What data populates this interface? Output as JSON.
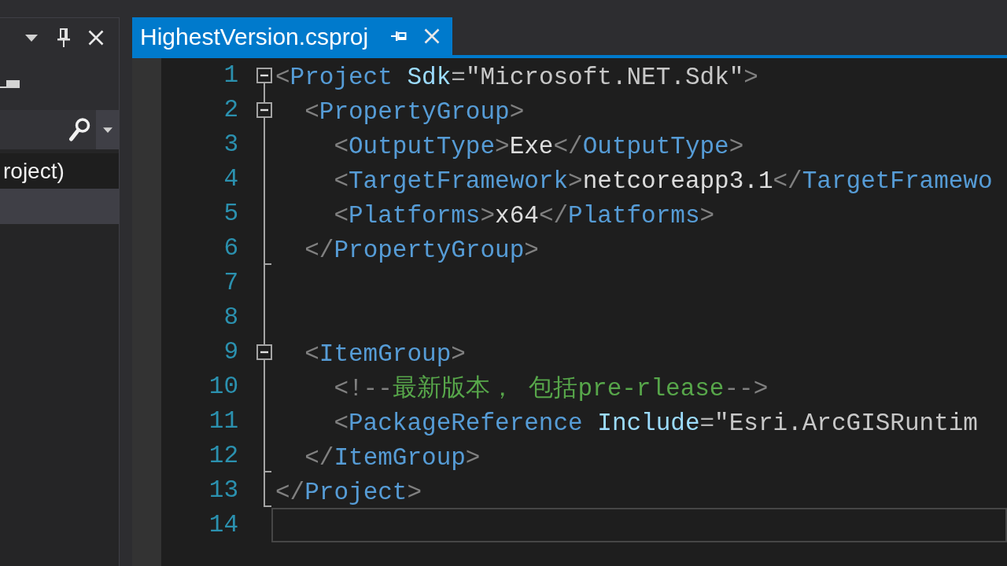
{
  "tool_window": {
    "tree_items": [
      {
        "label": "roject)",
        "selected": false
      },
      {
        "selected": true
      }
    ]
  },
  "tabs": [
    {
      "title": "HighestVersion.csproj",
      "selected": true
    }
  ],
  "editor": {
    "lines": [
      {
        "number": "1",
        "kind": "fold_start",
        "expanded": true,
        "current": false,
        "tokens": [
          {
            "kind": "delimiter",
            "text": "<"
          },
          {
            "kind": "element",
            "text": "Project"
          },
          {
            "kind": "attribute",
            "text": " Sdk"
          },
          {
            "kind": "operator",
            "text": "="
          },
          {
            "kind": "value",
            "text": "\"Microsoft.NET.Sdk\""
          },
          {
            "kind": "delimiter",
            "text": ">"
          }
        ],
        "children": [
          {
            "number": "2",
            "kind": "fold_start",
            "expanded": true,
            "current": false,
            "tokens": [
              {
                "kind": "delimiter",
                "text": "<"
              },
              {
                "kind": "element",
                "text": "PropertyGroup"
              },
              {
                "kind": "delimiter",
                "text": ">"
              }
            ],
            "children": [
              {
                "number": "3",
                "kind": "fold_inner",
                "current": false,
                "tokens": [
                  {
                    "kind": "delimiter",
                    "text": "<"
                  },
                  {
                    "kind": "element",
                    "text": "OutputType"
                  },
                  {
                    "kind": "delimiter",
                    "text": ">"
                  },
                  {
                    "kind": "text",
                    "text": "Exe"
                  },
                  {
                    "kind": "delimiter",
                    "text": "</"
                  },
                  {
                    "kind": "element",
                    "text": "OutputType"
                  },
                  {
                    "kind": "delimiter",
                    "text": ">"
                  }
                ]
              },
              {
                "number": "4",
                "kind": "fold_inner",
                "current": false,
                "tokens": [
                  {
                    "kind": "delimiter",
                    "text": "<"
                  },
                  {
                    "kind": "element",
                    "text": "TargetFramework"
                  },
                  {
                    "kind": "delimiter",
                    "text": ">"
                  },
                  {
                    "kind": "text",
                    "text": "netcoreapp3.1"
                  },
                  {
                    "kind": "delimiter",
                    "text": "</"
                  },
                  {
                    "kind": "element",
                    "text": "TargetFramewo"
                  }
                ]
              },
              {
                "number": "5",
                "kind": "fold_inner",
                "current": false,
                "tokens": [
                  {
                    "kind": "delimiter",
                    "text": "<"
                  },
                  {
                    "kind": "element",
                    "text": "Platforms"
                  },
                  {
                    "kind": "delimiter",
                    "text": ">"
                  },
                  {
                    "kind": "text",
                    "text": "x64"
                  },
                  {
                    "kind": "delimiter",
                    "text": "</"
                  },
                  {
                    "kind": "element",
                    "text": "Platforms"
                  },
                  {
                    "kind": "delimiter",
                    "text": ">"
                  }
                ]
              }
            ]
          },
          {
            "number": "6",
            "kind": "fold_end",
            "current": false,
            "tokens": [
              {
                "kind": "delimiter",
                "text": "</"
              },
              {
                "kind": "element",
                "text": "PropertyGroup"
              },
              {
                "kind": "delimiter",
                "text": ">"
              }
            ]
          },
          {
            "number": "7",
            "kind": "fold_inner",
            "current": false
          },
          {
            "number": "8",
            "kind": "fold_inner",
            "current": false
          },
          {
            "number": "9",
            "kind": "fold_start",
            "expanded": true,
            "current": false,
            "tokens": [
              {
                "kind": "delimiter",
                "text": "<"
              },
              {
                "kind": "element",
                "text": "ItemGroup"
              },
              {
                "kind": "delimiter",
                "text": ">"
              }
            ],
            "children": [
              {
                "number": "10",
                "kind": "fold_inner",
                "current": false,
                "tokens": [
                  {
                    "kind": "delimiter",
                    "text": "<!--"
                  },
                  {
                    "kind": "comment",
                    "text": "最新版本， 包括pre-rlease"
                  },
                  {
                    "kind": "delimiter",
                    "text": "-->"
                  }
                ]
              },
              {
                "number": "11",
                "kind": "fold_inner",
                "current": false,
                "tokens": [
                  {
                    "kind": "delimiter",
                    "text": "<"
                  },
                  {
                    "kind": "element",
                    "text": "PackageReference"
                  },
                  {
                    "kind": "attribute",
                    "text": " Include"
                  },
                  {
                    "kind": "operator",
                    "text": "="
                  },
                  {
                    "kind": "value",
                    "text": "\"Esri.ArcGISRuntim"
                  }
                ]
              }
            ]
          },
          {
            "number": "12",
            "kind": "fold_end",
            "current": false,
            "tokens": [
              {
                "kind": "delimiter",
                "text": "</"
              },
              {
                "kind": "element",
                "text": "ItemGroup"
              },
              {
                "kind": "delimiter",
                "text": ">"
              }
            ]
          }
        ]
      },
      {
        "number": "13",
        "kind": "fold_end",
        "current": false,
        "tokens": [
          {
            "kind": "delimiter",
            "text": "</"
          },
          {
            "kind": "element",
            "text": "Project"
          },
          {
            "kind": "delimiter",
            "text": ">"
          }
        ]
      },
      {
        "number": "14",
        "kind": "plain",
        "current": true
      }
    ]
  }
}
